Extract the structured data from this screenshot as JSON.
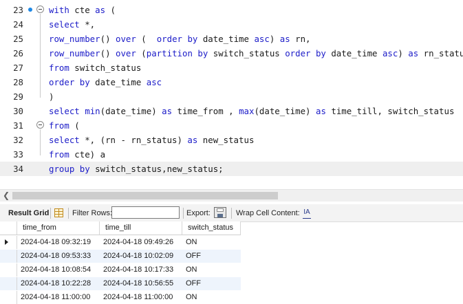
{
  "editor": {
    "lines": [
      {
        "num": "23",
        "tokens": [
          [
            "k",
            "with"
          ],
          [
            "p",
            " cte "
          ],
          [
            "k",
            "as"
          ],
          [
            "p",
            " ("
          ]
        ]
      },
      {
        "num": "24",
        "tokens": [
          [
            "k",
            "select"
          ],
          [
            "p",
            " *,"
          ]
        ]
      },
      {
        "num": "25",
        "tokens": [
          [
            "k",
            "row_number"
          ],
          [
            "p",
            "() "
          ],
          [
            "k",
            "over"
          ],
          [
            "p",
            " (  "
          ],
          [
            "k",
            "order by"
          ],
          [
            "p",
            " date_time "
          ],
          [
            "k",
            "asc"
          ],
          [
            "p",
            ") "
          ],
          [
            "k",
            "as"
          ],
          [
            "p",
            " rn,"
          ]
        ]
      },
      {
        "num": "26",
        "tokens": [
          [
            "k",
            "row_number"
          ],
          [
            "p",
            "() "
          ],
          [
            "k",
            "over"
          ],
          [
            "p",
            " ("
          ],
          [
            "k",
            "partition by"
          ],
          [
            "p",
            " switch_status "
          ],
          [
            "k",
            "order by"
          ],
          [
            "p",
            " date_time "
          ],
          [
            "k",
            "asc"
          ],
          [
            "p",
            ") "
          ],
          [
            "k",
            "as"
          ],
          [
            "p",
            " rn_status"
          ]
        ]
      },
      {
        "num": "27",
        "tokens": [
          [
            "k",
            "from"
          ],
          [
            "p",
            " switch_status"
          ]
        ]
      },
      {
        "num": "28",
        "tokens": [
          [
            "k",
            "order by"
          ],
          [
            "p",
            " date_time "
          ],
          [
            "k",
            "asc"
          ]
        ]
      },
      {
        "num": "29",
        "tokens": [
          [
            "p",
            ")"
          ]
        ]
      },
      {
        "num": "30",
        "tokens": [
          [
            "k",
            "select"
          ],
          [
            "p",
            " "
          ],
          [
            "k",
            "min"
          ],
          [
            "p",
            "(date_time) "
          ],
          [
            "k",
            "as"
          ],
          [
            "p",
            " time_from , "
          ],
          [
            "k",
            "max"
          ],
          [
            "p",
            "(date_time) "
          ],
          [
            "k",
            "as"
          ],
          [
            "p",
            " time_till, switch_status"
          ]
        ]
      },
      {
        "num": "31",
        "tokens": [
          [
            "k",
            "from"
          ],
          [
            "p",
            " ("
          ]
        ]
      },
      {
        "num": "32",
        "tokens": [
          [
            "k",
            "select"
          ],
          [
            "p",
            " *, (rn - rn_status) "
          ],
          [
            "k",
            "as"
          ],
          [
            "p",
            " new_status"
          ]
        ]
      },
      {
        "num": "33",
        "tokens": [
          [
            "k",
            "from"
          ],
          [
            "p",
            " cte) a"
          ]
        ]
      },
      {
        "num": "34",
        "tokens": [
          [
            "k",
            "group by"
          ],
          [
            "p",
            " switch_status,new_status;"
          ]
        ]
      }
    ],
    "current_line": "34",
    "fold_lines": [
      "23",
      "31"
    ],
    "breakpoint_lines": [
      "23"
    ]
  },
  "toolbar": {
    "result_grid_label": "Result Grid",
    "filter_rows_label": "Filter Rows:",
    "filter_value": "",
    "export_label": "Export:",
    "wrap_label": "Wrap Cell Content:",
    "wrap_icon_glyph": "IA"
  },
  "grid": {
    "columns": [
      "time_from",
      "time_till",
      "switch_status"
    ],
    "rows": [
      [
        "2024-04-18 09:32:19",
        "2024-04-18 09:49:26",
        "ON"
      ],
      [
        "2024-04-18 09:53:33",
        "2024-04-18 10:02:09",
        "OFF"
      ],
      [
        "2024-04-18 10:08:54",
        "2024-04-18 10:17:33",
        "ON"
      ],
      [
        "2024-04-18 10:22:28",
        "2024-04-18 10:56:55",
        "OFF"
      ],
      [
        "2024-04-18 11:00:00",
        "2024-04-18 11:00:00",
        "ON"
      ]
    ],
    "selected_row": 0
  },
  "colors": {
    "keyword": "#1b1bc8",
    "current_line_bg": "#efefef",
    "alt_row_bg": "#eef4fc",
    "breakpoint": "#1e88e5"
  }
}
